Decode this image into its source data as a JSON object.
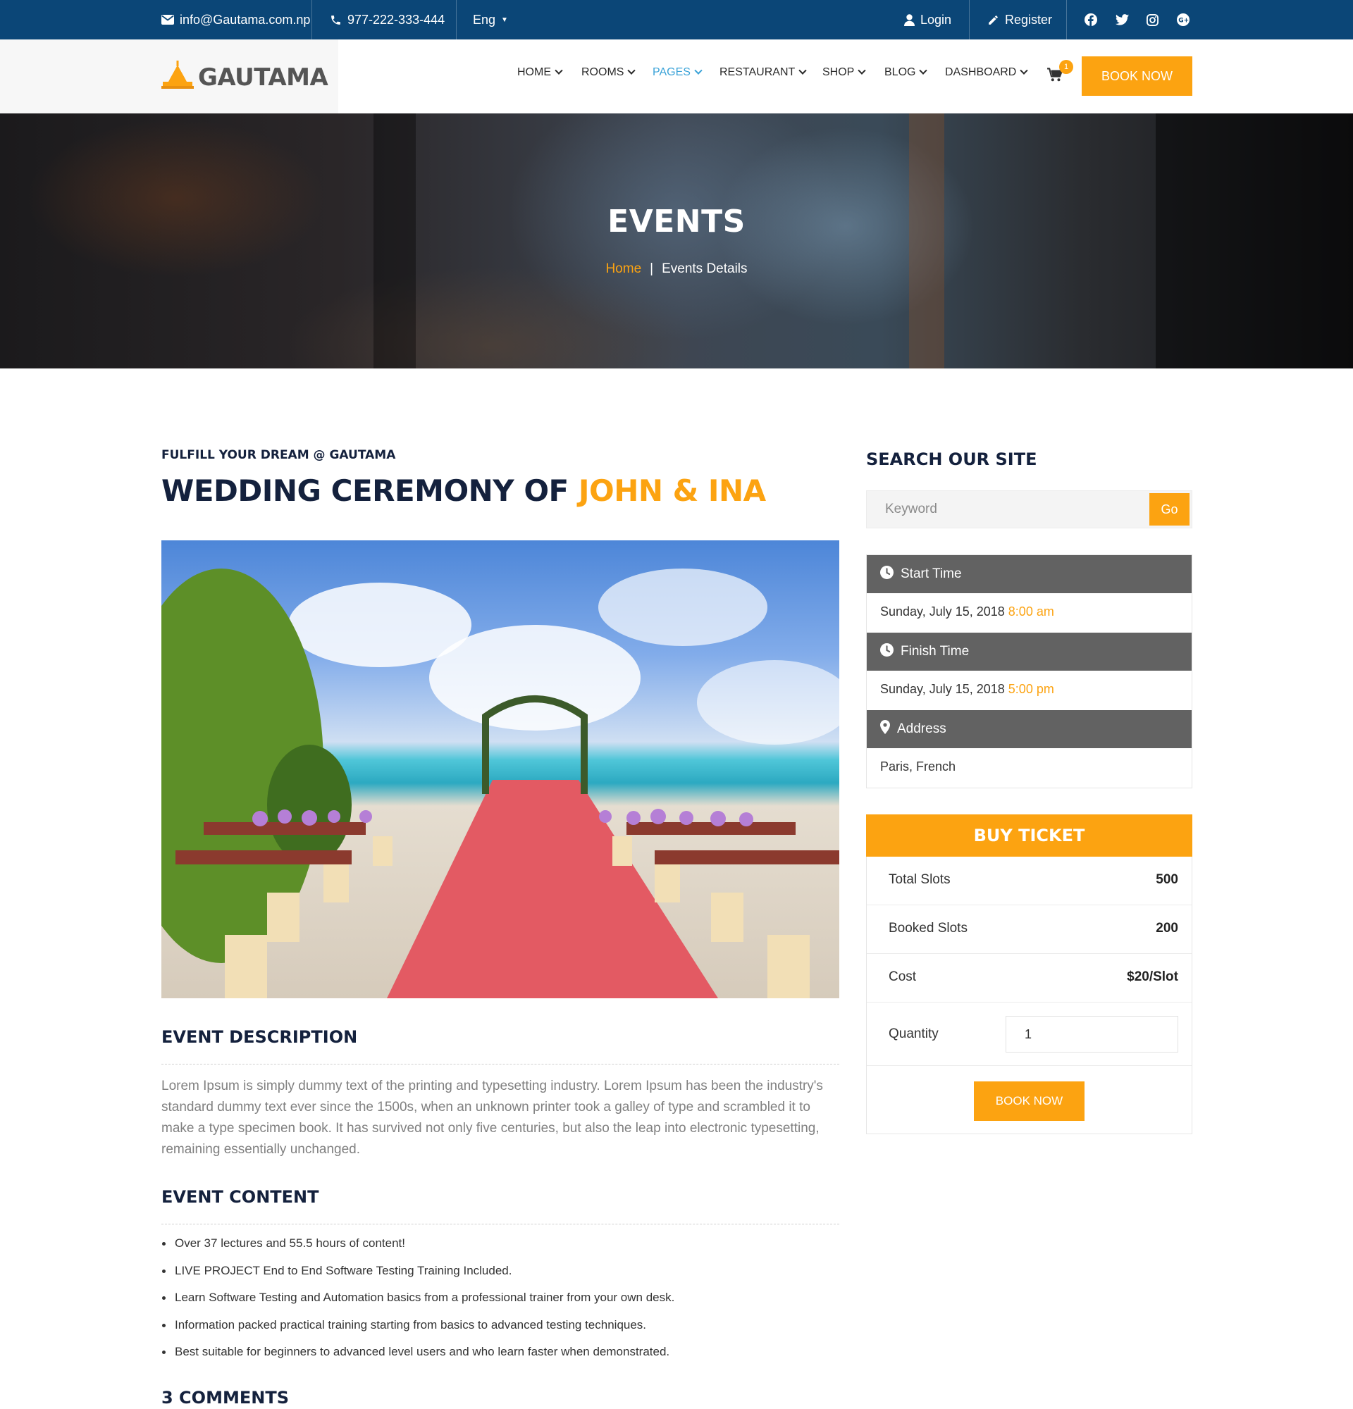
{
  "topbar": {
    "email": "info@Gautama.com.np",
    "phone": "977-222-333-444",
    "language": "Eng",
    "login": "Login",
    "register": "Register"
  },
  "header": {
    "logo_text": "GAUTAMA",
    "nav": [
      {
        "label": "HOME"
      },
      {
        "label": "ROOMS"
      },
      {
        "label": "PAGES"
      },
      {
        "label": "RESTAURANT"
      },
      {
        "label": "SHOP"
      },
      {
        "label": "BLOG"
      },
      {
        "label": "DASHBOARD"
      }
    ],
    "active_nav": "PAGES",
    "cart_count": "1",
    "book_now": "BOOK NOW"
  },
  "hero": {
    "title": "EVENTS",
    "crumb_home": "Home",
    "crumb_separator": "|",
    "crumb_current": "Events Details"
  },
  "event": {
    "kicker": "FULFILL YOUR DREAM @ GAUTAMA",
    "title_main": "WEDDING CEREMONY OF",
    "title_accent": "JOHN & INA",
    "description_heading": "EVENT DESCRIPTION",
    "description": "Lorem Ipsum is simply dummy text of the printing and typesetting industry. Lorem Ipsum has been the industry's standard dummy text ever since the 1500s, when an unknown printer took a galley of type and scrambled it to make a type specimen book. It has survived not only five centuries, but also the leap into electronic typesetting, remaining essentially unchanged.",
    "content_heading": "EVENT CONTENT",
    "content_items": [
      "Over 37 lectures and 55.5 hours of content!",
      "LIVE PROJECT End to End Software Testing Training Included.",
      "Learn Software Testing and Automation basics from a professional trainer from your own desk.",
      "Information packed practical training starting from basics to advanced testing techniques.",
      "Best suitable for beginners to advanced level users and who learn faster when demonstrated."
    ],
    "comments_heading": "3 COMMENTS"
  },
  "sidebar": {
    "search_title": "SEARCH OUR SITE",
    "search_placeholder": "Keyword",
    "search_button": "Go",
    "start_label": "Start Time",
    "start_date": "Sunday, July 15, 2018",
    "start_time": "8:00 am",
    "finish_label": "Finish Time",
    "finish_date": "Sunday, July 15, 2018",
    "finish_time": "5:00 pm",
    "address_label": "Address",
    "address_value": "Paris, French"
  },
  "ticket": {
    "heading": "BUY TICKET",
    "total_label": "Total Slots",
    "total_value": "500",
    "booked_label": "Booked Slots",
    "booked_value": "200",
    "cost_label": "Cost",
    "cost_value": "$20/Slot",
    "quantity_label": "Quantity",
    "quantity_value": "1",
    "book_now": "BOOK NOW"
  },
  "colors": {
    "topbar": "#0b4677",
    "accent": "#fca311",
    "heading": "#14213d",
    "nav_active": "#3ba3d8",
    "info_header": "#626262"
  },
  "icons": {
    "email": "envelope-icon",
    "phone": "phone-icon",
    "login": "user-icon",
    "register": "pencil-icon",
    "social": [
      "facebook-icon",
      "twitter-icon",
      "instagram-icon",
      "google-plus-icon"
    ],
    "cart": "cart-icon",
    "start": "clock-icon",
    "finish": "clock-icon",
    "address": "map-pin-icon"
  }
}
